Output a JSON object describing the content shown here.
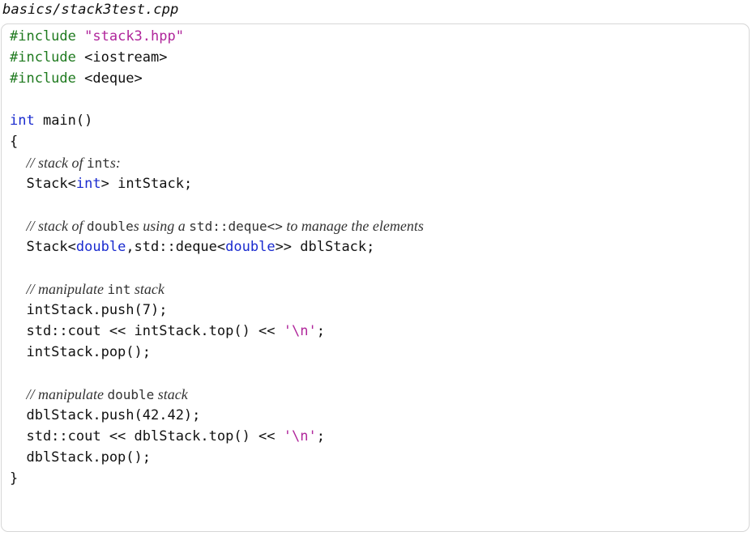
{
  "document": {
    "filename": "basics/stack3test.cpp"
  },
  "code": {
    "lines": [
      {
        "tokens": [
          {
            "t": "pp",
            "v": "#include"
          },
          {
            "t": "txt",
            "v": " "
          },
          {
            "t": "str",
            "v": "\"stack3.hpp\""
          }
        ]
      },
      {
        "tokens": [
          {
            "t": "pp",
            "v": "#include"
          },
          {
            "t": "txt",
            "v": " <iostream>"
          }
        ]
      },
      {
        "tokens": [
          {
            "t": "pp",
            "v": "#include"
          },
          {
            "t": "txt",
            "v": " <deque>"
          }
        ]
      },
      {
        "tokens": []
      },
      {
        "tokens": [
          {
            "t": "kw",
            "v": "int"
          },
          {
            "t": "txt",
            "v": " main()"
          }
        ]
      },
      {
        "tokens": [
          {
            "t": "txt",
            "v": "{"
          }
        ]
      },
      {
        "tokens": [
          {
            "t": "txt",
            "v": "  "
          },
          {
            "t": "cmt",
            "v": "// stack of "
          },
          {
            "t": "cmt-code",
            "v": "int"
          },
          {
            "t": "cmt",
            "v": "s:"
          }
        ]
      },
      {
        "tokens": [
          {
            "t": "txt",
            "v": "  Stack<"
          },
          {
            "t": "kw",
            "v": "int"
          },
          {
            "t": "txt",
            "v": "> intStack;"
          }
        ]
      },
      {
        "tokens": []
      },
      {
        "tokens": [
          {
            "t": "txt",
            "v": "  "
          },
          {
            "t": "cmt",
            "v": "// stack of "
          },
          {
            "t": "cmt-code",
            "v": "double"
          },
          {
            "t": "cmt",
            "v": "s using a "
          },
          {
            "t": "cmt-code",
            "v": "std::deque<>"
          },
          {
            "t": "cmt",
            "v": " to manage the elements"
          }
        ]
      },
      {
        "tokens": [
          {
            "t": "txt",
            "v": "  Stack<"
          },
          {
            "t": "kw",
            "v": "double"
          },
          {
            "t": "txt",
            "v": ",std::deque<"
          },
          {
            "t": "kw",
            "v": "double"
          },
          {
            "t": "txt",
            "v": ">> dblStack;"
          }
        ]
      },
      {
        "tokens": []
      },
      {
        "tokens": [
          {
            "t": "txt",
            "v": "  "
          },
          {
            "t": "cmt",
            "v": "// manipulate "
          },
          {
            "t": "cmt-code",
            "v": "int"
          },
          {
            "t": "cmt",
            "v": " stack"
          }
        ]
      },
      {
        "tokens": [
          {
            "t": "txt",
            "v": "  intStack.push(7);"
          }
        ]
      },
      {
        "tokens": [
          {
            "t": "txt",
            "v": "  std::cout << intStack.top() << "
          },
          {
            "t": "str",
            "v": "'\\n'"
          },
          {
            "t": "txt",
            "v": ";"
          }
        ]
      },
      {
        "tokens": [
          {
            "t": "txt",
            "v": "  intStack.pop();"
          }
        ]
      },
      {
        "tokens": []
      },
      {
        "tokens": [
          {
            "t": "txt",
            "v": "  "
          },
          {
            "t": "cmt",
            "v": "// manipulate "
          },
          {
            "t": "cmt-code",
            "v": "double"
          },
          {
            "t": "cmt",
            "v": " stack"
          }
        ]
      },
      {
        "tokens": [
          {
            "t": "txt",
            "v": "  dblStack.push(42.42);"
          }
        ]
      },
      {
        "tokens": [
          {
            "t": "txt",
            "v": "  std::cout << dblStack.top() << "
          },
          {
            "t": "str",
            "v": "'\\n'"
          },
          {
            "t": "txt",
            "v": ";"
          }
        ]
      },
      {
        "tokens": [
          {
            "t": "txt",
            "v": "  dblStack.pop();"
          }
        ]
      },
      {
        "tokens": [
          {
            "t": "txt",
            "v": "}"
          }
        ]
      }
    ]
  },
  "colors": {
    "preprocessor": "#1f7a1f",
    "string": "#b0269b",
    "keyword": "#1a2bcf",
    "text": "#111111",
    "comment": "#333333",
    "box_border": "#d6d6d6"
  }
}
